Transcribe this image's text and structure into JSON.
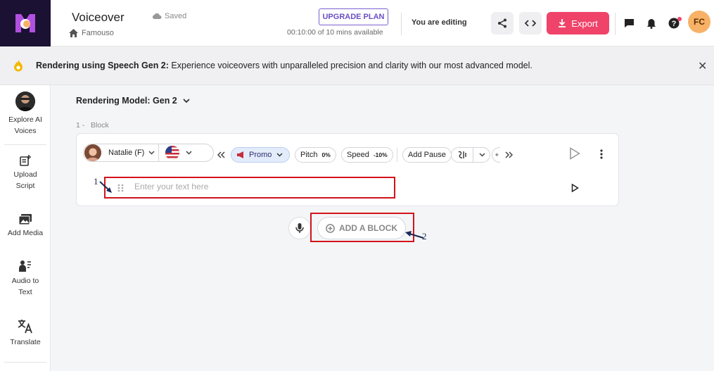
{
  "header": {
    "title": "Voiceover",
    "saved_label": "Saved",
    "breadcrumb": "Famouso",
    "upgrade_label": "UPGRADE PLAN",
    "minutes": "00:10:00 of 10 mins available",
    "editing_label": "You are editing",
    "export_label": "Export",
    "avatar_initials": "FC"
  },
  "banner": {
    "bold_text": "Rendering using Speech Gen 2:",
    "text": " Experience voiceovers with unparalleled precision and clarity with our most advanced model."
  },
  "sidebar": {
    "items": [
      {
        "label": "Explore AI Voices"
      },
      {
        "label": "Upload Script"
      },
      {
        "label": "Add Media"
      },
      {
        "label": "Audio to Text"
      },
      {
        "label": "Translate"
      }
    ]
  },
  "main": {
    "model_label": "Rendering Model: Gen 2",
    "block_number": "1 -",
    "block_label": "Block",
    "voice_name": "Natalie (F)",
    "style_label": "Promo",
    "pitch_label": "Pitch",
    "pitch_value": "0%",
    "speed_label": "Speed",
    "speed_value": "-10%",
    "pause_label": "Add Pause",
    "text_placeholder": "Enter your text here",
    "add_block_label": "ADD A BLOCK"
  },
  "annotations": {
    "label_1": "1",
    "label_2": "2"
  },
  "colors": {
    "accent": "#f0436a",
    "brand_purple": "#6a4fc7",
    "annotation_red": "#d2141c"
  }
}
